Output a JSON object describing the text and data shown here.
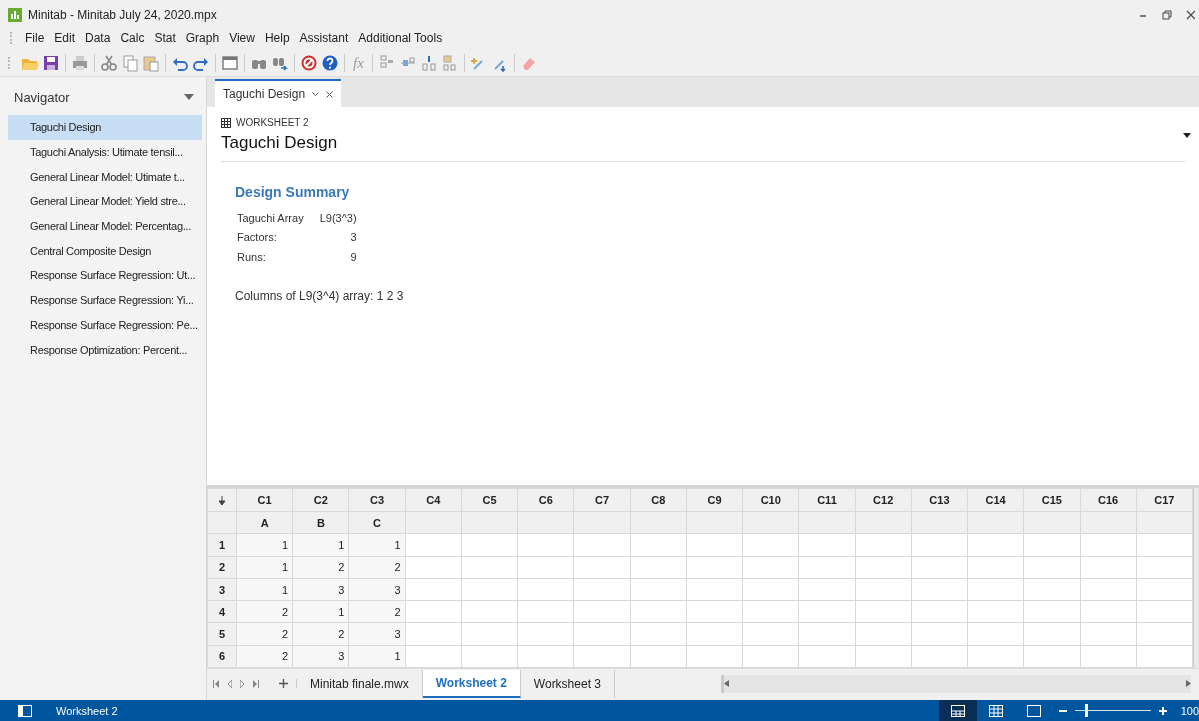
{
  "window": {
    "title": "Minitab - Minitab July 24, 2020.mpx"
  },
  "menu": [
    "File",
    "Edit",
    "Data",
    "Calc",
    "Stat",
    "Graph",
    "View",
    "Help",
    "Assistant",
    "Additional Tools"
  ],
  "toolbar": {
    "formula_label": "fx"
  },
  "navigator": {
    "title": "Navigator",
    "items": [
      {
        "label": "Taguchi Design",
        "selected": true
      },
      {
        "label": "Taguchi Analysis: Utimate tensil...",
        "selected": false
      },
      {
        "label": "General Linear Model: Utimate t...",
        "selected": false
      },
      {
        "label": "General Linear Model: Yield stre...",
        "selected": false
      },
      {
        "label": "General Linear Model: Percentag...",
        "selected": false
      },
      {
        "label": "Central Composite Design",
        "selected": false
      },
      {
        "label": "Response Surface Regression: Ut...",
        "selected": false
      },
      {
        "label": "Response Surface Regression: Yi...",
        "selected": false
      },
      {
        "label": "Response Surface Regression: Pe...",
        "selected": false
      },
      {
        "label": "Response Optimization: Percent...",
        "selected": false
      }
    ]
  },
  "output": {
    "tabs": [
      {
        "label": "Taguchi Design",
        "selected": true
      }
    ],
    "worksheet_label": "WORKSHEET 2",
    "title": "Taguchi Design",
    "section_title": "Design Summary",
    "summary": [
      {
        "label": "Taguchi Array",
        "value": "L9(3^3)"
      },
      {
        "label": "Factors:",
        "value": "3"
      },
      {
        "label": "Runs:",
        "value": "9"
      }
    ],
    "note": "Columns of L9(3^4) array: 1 2 3"
  },
  "worksheet": {
    "columns": [
      {
        "label": "C1",
        "name": "A"
      },
      {
        "label": "C2",
        "name": "B"
      },
      {
        "label": "C3",
        "name": "C"
      },
      {
        "label": "C4"
      },
      {
        "label": "C5"
      },
      {
        "label": "C6"
      },
      {
        "label": "C7"
      },
      {
        "label": "C8"
      },
      {
        "label": "C9"
      },
      {
        "label": "C10"
      },
      {
        "label": "C11"
      },
      {
        "label": "C12"
      },
      {
        "label": "C13"
      },
      {
        "label": "C14"
      },
      {
        "label": "C15"
      },
      {
        "label": "C16"
      },
      {
        "label": "C17"
      }
    ],
    "rows": [
      {
        "label": "1",
        "cells": [
          "1",
          "1",
          "1"
        ]
      },
      {
        "label": "2",
        "cells": [
          "1",
          "2",
          "2"
        ]
      },
      {
        "label": "3",
        "cells": [
          "1",
          "3",
          "3"
        ]
      },
      {
        "label": "4",
        "cells": [
          "2",
          "1",
          "2"
        ]
      },
      {
        "label": "5",
        "cells": [
          "2",
          "2",
          "3"
        ]
      },
      {
        "label": "6",
        "cells": [
          "2",
          "3",
          "1"
        ]
      }
    ]
  },
  "sheet_tabs": [
    {
      "label": "Minitab finale.mwx",
      "selected": false
    },
    {
      "label": "Worksheet 2",
      "selected": true
    },
    {
      "label": "Worksheet 3",
      "selected": false
    }
  ],
  "status_bar": {
    "text": "Worksheet 2",
    "views": [
      {
        "kind": "worksheet",
        "selected": true
      },
      {
        "kind": "grid",
        "selected": false
      },
      {
        "kind": "blank",
        "selected": false
      }
    ],
    "zoom": {
      "level": 0.13,
      "reading": "100"
    }
  }
}
